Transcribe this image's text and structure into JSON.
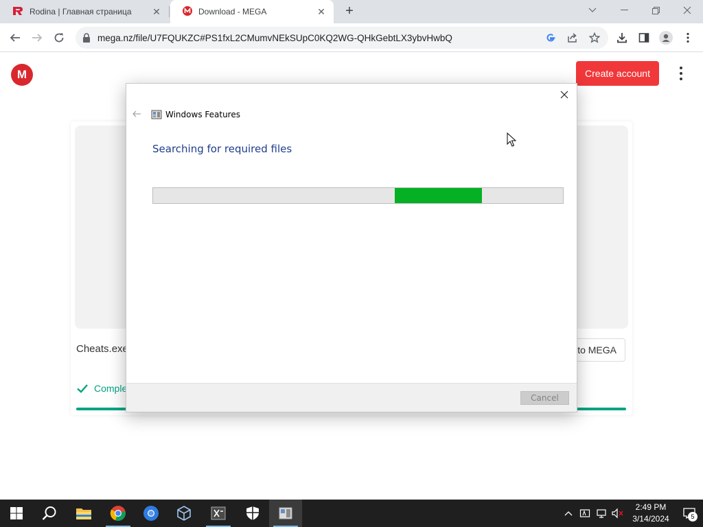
{
  "browser": {
    "tabs": [
      {
        "title": "Rodina | Главная страница",
        "favicon": "rodina-r-icon",
        "active": false
      },
      {
        "title": "Download - MEGA",
        "favicon": "mega-icon",
        "active": true
      }
    ],
    "url": "mega.nz/file/U7FQUKZC#PS1fxL2CMumvNEkSUpC0KQ2WG-QHkGebtLX3ybvHwbQ"
  },
  "mega": {
    "logo_letter": "M",
    "create_account_label": "Create account",
    "file_name": "Cheats.exe",
    "import_label": "to MEGA",
    "status_label": "Complete",
    "brand_color": "#d9272e",
    "status_color": "#00a382"
  },
  "dialog": {
    "title": "Windows Features",
    "heading": "Searching for required files",
    "cancel_label": "Cancel",
    "progress": {
      "type": "indeterminate-marquee",
      "fill_color": "#06b025"
    }
  },
  "taskbar": {
    "apps": [
      "start-icon",
      "search-icon",
      "file-explorer-icon",
      "chrome-icon",
      "chromium-icon",
      "virtualbox-icon",
      "app-icon",
      "security-shield-icon",
      "windows-features-icon"
    ],
    "time": "2:49 PM",
    "date": "3/14/2024",
    "notification_count": "5"
  }
}
